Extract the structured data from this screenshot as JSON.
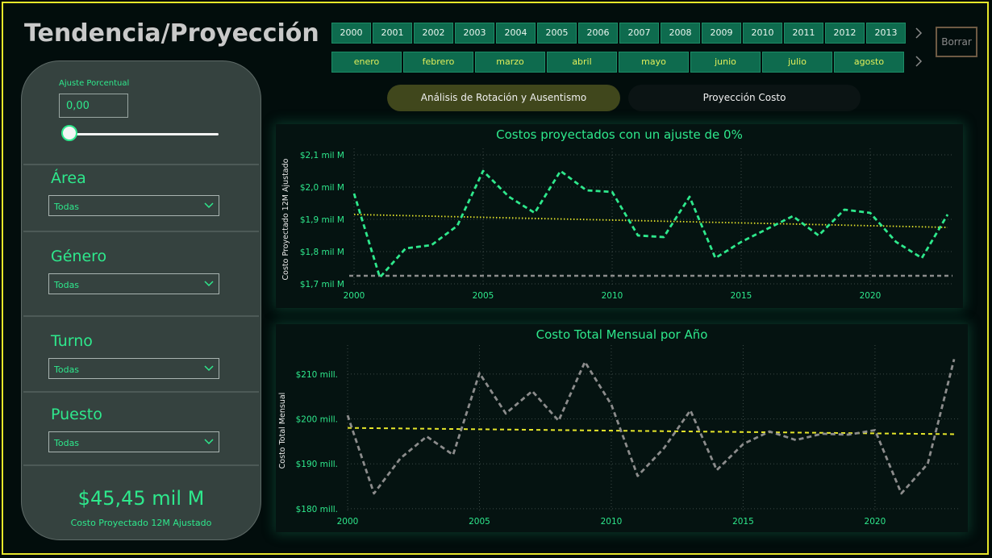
{
  "page": {
    "title": "Tendencia/Proyección"
  },
  "slicers": {
    "years": [
      "2000",
      "2001",
      "2002",
      "2003",
      "2004",
      "2005",
      "2006",
      "2007",
      "2008",
      "2009",
      "2010",
      "2011",
      "2012",
      "2013"
    ],
    "months": [
      "enero",
      "febrero",
      "marzo",
      "abril",
      "mayo",
      "junio",
      "julio",
      "agosto"
    ],
    "clear_label": "Borrar"
  },
  "sidebar": {
    "adjust_label": "Ajuste Porcentual",
    "adjust_value": "0,00",
    "slider_value": 0,
    "filters": [
      {
        "label": "Área",
        "value": "Todas"
      },
      {
        "label": "Género",
        "value": "Todas"
      },
      {
        "label": "Turno",
        "value": "Todas"
      },
      {
        "label": "Puesto",
        "value": "Todas"
      }
    ],
    "kpi_value": "$45,45 mil M",
    "kpi_label": "Costo Proyectado 12M Ajustado"
  },
  "tabs": [
    {
      "label": "Análisis de Rotación y Ausentismo",
      "active": true
    },
    {
      "label": "Proyección Costo",
      "active": false
    }
  ],
  "colors": {
    "accent": "#2ee88c",
    "trend": "#e6e62a",
    "frame": "#e6e62a",
    "gray_series": "#8c8c8c"
  },
  "chart_data": [
    {
      "type": "line",
      "title": "Costos proyectados con un ajuste de 0%",
      "xlabel": "",
      "ylabel": "Costo Proyectado 12M Ajustado",
      "x": [
        2000,
        2001,
        2002,
        2003,
        2004,
        2005,
        2006,
        2007,
        2008,
        2009,
        2010,
        2011,
        2012,
        2013,
        2014,
        2015,
        2016,
        2017,
        2018,
        2019,
        2020,
        2021,
        2022,
        2023
      ],
      "x_ticks": [
        "2000",
        "2005",
        "2010",
        "2015",
        "2020"
      ],
      "y_ticks": [
        "$1,7 mil M",
        "$1,8 mil M",
        "$1,9 mil M",
        "$2,0 mil M",
        "$2,1 mil M"
      ],
      "ylim": [
        1.7,
        2.1
      ],
      "series": [
        {
          "values": [
            1.98,
            1.72,
            1.81,
            1.82,
            1.88,
            2.05,
            1.97,
            1.92,
            2.05,
            1.99,
            1.985,
            1.85,
            1.845,
            1.97,
            1.78,
            1.83,
            1.87,
            1.91,
            1.85,
            1.93,
            1.92,
            1.83,
            1.78,
            1.915
          ],
          "color": "#2ee88c",
          "style": "dashed"
        }
      ],
      "trend": {
        "start": 1.915,
        "end": 1.875,
        "color": "#e6e62a",
        "style": "dotted"
      },
      "reference": {
        "value": 1.725,
        "color": "#8c8c8c",
        "style": "dashed"
      },
      "grid": true
    },
    {
      "type": "line",
      "title": "Costo Total Mensual por Año",
      "xlabel": "",
      "ylabel": "Costo Total Mensual",
      "x": [
        2000,
        2001,
        2002,
        2003,
        2004,
        2005,
        2006,
        2007,
        2008,
        2009,
        2010,
        2011,
        2012,
        2013,
        2014,
        2015,
        2016,
        2017,
        2018,
        2019,
        2020,
        2021,
        2022,
        2023
      ],
      "x_ticks": [
        "2000",
        "2005",
        "2010",
        "2015",
        "2020"
      ],
      "y_ticks": [
        "$180 mill.",
        "$190 mill.",
        "$200 mill.",
        "$210 mill."
      ],
      "ylim": [
        179.8,
        215
      ],
      "series": [
        {
          "values": [
            200.8,
            183.4,
            191.2,
            196.1,
            192.0,
            210.2,
            201.2,
            206.2,
            199.6,
            212.7,
            203.2,
            187.3,
            193.5,
            201.9,
            188.6,
            194.4,
            197.2,
            195.3,
            196.7,
            196.5,
            197.5,
            183.4,
            190.0,
            213.3
          ],
          "color": "#8c8c8c",
          "style": "dashed"
        }
      ],
      "trend": {
        "start": 198.0,
        "end": 196.6,
        "color": "#e6e62a",
        "style": "dashed"
      },
      "grid": true
    }
  ]
}
